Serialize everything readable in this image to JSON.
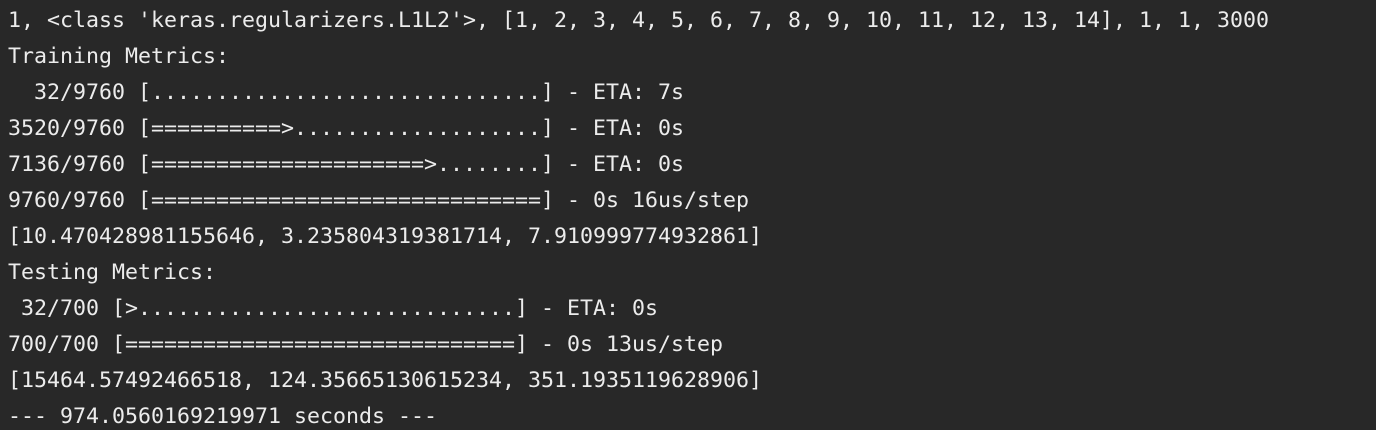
{
  "terminal": {
    "lines": [
      "1, <class 'keras.regularizers.L1L2'>, [1, 2, 3, 4, 5, 6, 7, 8, 9, 10, 11, 12, 13, 14], 1, 1, 3000",
      "Training Metrics:",
      "  32/9760 [..............................] - ETA: 7s",
      "3520/9760 [==========>...................] - ETA: 0s",
      "7136/9760 [=====================>........] - ETA: 0s",
      "9760/9760 [==============================] - 0s 16us/step",
      "[10.470428981155646, 3.235804319381714, 7.910999774932861]",
      "Testing Metrics:",
      " 32/700 [>.............................] - ETA: 0s",
      "700/700 [==============================] - 0s 13us/step",
      "[15464.57492466518, 124.35665130615234, 351.1935119628906]",
      "--- 974.0560169219971 seconds ---"
    ]
  }
}
